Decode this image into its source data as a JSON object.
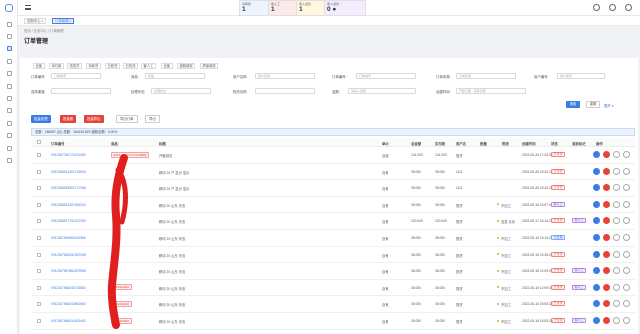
{
  "topbar": {
    "stats": [
      {
        "label": "待审核",
        "value": "1"
      },
      {
        "label": "客人工",
        "value": "1"
      },
      {
        "label": "客人退款",
        "value": "1"
      },
      {
        "label": "客人退款",
        "value": "0 ●"
      }
    ]
  },
  "tags": [
    "控制中心 ×",
    "订单管理 ×"
  ],
  "breadcrumb": "首页  /  业务中心  /  订单管理",
  "page_title": "订单管理",
  "filter_tabs": [
    "全部",
    "待付款",
    "待发货",
    "待收货",
    "已收货",
    "已完成",
    "客人工",
    "全部",
    "退款维权",
    "质量维权"
  ],
  "filters": [
    {
      "label": "订单编号:",
      "placeholder": "订单编号"
    },
    {
      "label": "商品:",
      "placeholder": "商品"
    },
    {
      "label": "用户名称:",
      "placeholder": "用户名称"
    },
    {
      "label": "订单编号:",
      "placeholder": "订单编号"
    },
    {
      "label": "订单来源:",
      "placeholder": "订单来源"
    },
    {
      "label": "用户编号:",
      "placeholder": "用户编号"
    },
    {
      "label": "选择渠道:",
      "placeholder": ""
    },
    {
      "label": "处理状态:",
      "placeholder": "处理状态"
    },
    {
      "label": "物流名称:",
      "placeholder": ""
    },
    {
      "label": "金额:",
      "placeholder": "请输入金额"
    },
    {
      "label": "创建时间:",
      "placeholder": "开始日期  -  结束日期"
    }
  ],
  "search_buttons": {
    "search": "搜索",
    "reset": "重置",
    "more": "展开 ▾"
  },
  "actions": [
    "批量处理",
    "批量删",
    "批量导出",
    "导出订单",
    "导出"
  ],
  "summary": "总数：160697 (元) 总额：164192.820 退款总额：0.00%",
  "columns": [
    "订单编号",
    "商品",
    "标题",
    "单价",
    "总金额",
    "实付款",
    "用户名",
    "数量",
    "物流",
    "创建时间",
    "状态",
    "商家标记",
    "操作"
  ],
  "rows": [
    {
      "id": "0912367760770221550",
      "product": "2019-09-16 07:01:00000",
      "title": "开箱测试",
      "type": "自营",
      "price": "124.200",
      "total": "124.200",
      "user": "提货",
      "qty": "",
      "ship": "",
      "ship_dot": false,
      "time": "2022-05-26 17:43:30",
      "status": "已付款",
      "status_class": "",
      "mark": ""
    },
    {
      "id": "0912368514401715094",
      "product": "",
      "title": "移动 20 户 显示 显示",
      "type": "自有",
      "price": "35.000",
      "total": "35.000",
      "user": "1111",
      "qty": "",
      "ship": "",
      "ship_dot": false,
      "time": "2022-05-26 15:42:12",
      "status": "已付款",
      "status_class": "",
      "mark": ""
    },
    {
      "id": "0912368515901717056",
      "product": "",
      "title": "移动 20 户 显示 显示",
      "type": "自有",
      "price": "35.000",
      "total": "35.000",
      "user": "1111",
      "qty": "",
      "ship": "",
      "ship_dot": false,
      "time": "2022-05-26 15:43:25",
      "status": "已付款",
      "status_class": "",
      "mark": ""
    },
    {
      "id": "0912368512321945224",
      "product": "",
      "title": "移动 20 山东 青岛",
      "type": "自有",
      "price": "35.000",
      "total": "35.000",
      "user": "提货",
      "qty": "",
      "ship": "不加工",
      "ship_dot": true,
      "time": "2022-05-16 15:57:47",
      "status": "客人工",
      "status_class": "purple",
      "mark": ""
    },
    {
      "id": "0912368571751372250",
      "product": "",
      "title": "移动 20 山东 青岛",
      "type": "自有",
      "price": "100.000",
      "total": "100.000",
      "user": "提货",
      "qty": "",
      "ship": "加急 北京",
      "ship_dot": true,
      "time": "2022-05-17 16:16:24",
      "status": "已付款",
      "status_class": "",
      "mark": "客人工"
    },
    {
      "id": "0912367560660244566",
      "product": "",
      "title": "移动 20 山东 青岛",
      "type": "自有",
      "price": "35.000",
      "total": "35.000",
      "user": "提货",
      "qty": "",
      "ship": "不加工",
      "ship_dot": true,
      "time": "2022-05-16 15:14:26",
      "status": "已处理",
      "status_class": "blue",
      "mark": ""
    },
    {
      "id": "0912367662531087056",
      "product": "",
      "title": "移动 20 山东 青岛",
      "type": "自有",
      "price": "35.000",
      "total": "35.000",
      "user": "提货",
      "qty": "",
      "ship": "不加工",
      "ship_dot": true,
      "time": "2022-05-16 15:36:25",
      "status": "已付款",
      "status_class": "",
      "mark": ""
    },
    {
      "id": "0912367567861879956",
      "product": "",
      "title": "移动 20 山东 青岛",
      "type": "自有",
      "price": "35.000",
      "total": "35.000",
      "user": "提货",
      "qty": "",
      "ship": "不加工",
      "ship_dot": true,
      "time": "2022-05-16 12:09:04",
      "status": "已付款",
      "status_class": "",
      "mark": "客人工"
    },
    {
      "id": "0912367566240733852",
      "product": "C24444232",
      "title": "移动 20 山东 青岛",
      "type": "自有",
      "price": "35.000",
      "total": "35.000",
      "user": "提货",
      "qty": "",
      "ship": "不加工",
      "ship_dot": true,
      "time": "2022-05-16 12:09:04",
      "status": "已付款",
      "status_class": "",
      "mark": "客人工"
    },
    {
      "id": "0912367566243962660",
      "product": "C24444232",
      "title": "移动 20 山东 青岛",
      "type": "自有",
      "price": "35.000",
      "total": "35.000",
      "user": "提货",
      "qty": "",
      "ship": "不加工",
      "ship_dot": true,
      "time": "2022-05-16 15:53:38",
      "status": "已付款",
      "status_class": "",
      "mark": ""
    },
    {
      "id": "0912367566244002462",
      "product": "C24444232",
      "title": "移动 20 山东 青岛",
      "type": "自有",
      "price": "35.000",
      "total": "35.000",
      "user": "提货",
      "qty": "",
      "ship": "不加工",
      "ship_dot": true,
      "time": "2022-05-16 15:53:30",
      "status": "已付款",
      "status_class": "",
      "mark": "客人工"
    }
  ]
}
